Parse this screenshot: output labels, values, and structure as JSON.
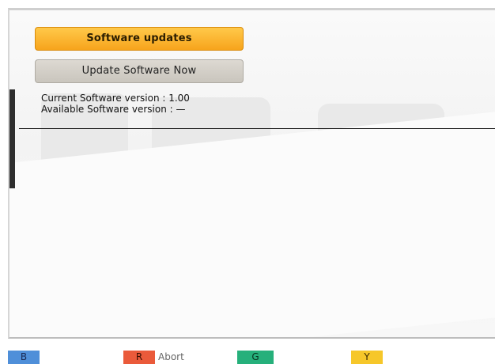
{
  "menu": {
    "software_updates_label": "Software updates",
    "update_now_label": "Update Software Now"
  },
  "info": {
    "current_version": "Current Software version : 1.00",
    "available_version": "Available Software version : —"
  },
  "footer": {
    "b_key": "B",
    "r_key": "R",
    "r_label": "Abort",
    "g_key": "G",
    "y_key": "Y"
  },
  "colors": {
    "selected_button": "#f7a41c",
    "normal_button": "#c9c5bd",
    "key_blue": "#4f8fd9",
    "key_red": "#ea5a3a",
    "key_green": "#26b07b",
    "key_yellow": "#f6c72a"
  }
}
